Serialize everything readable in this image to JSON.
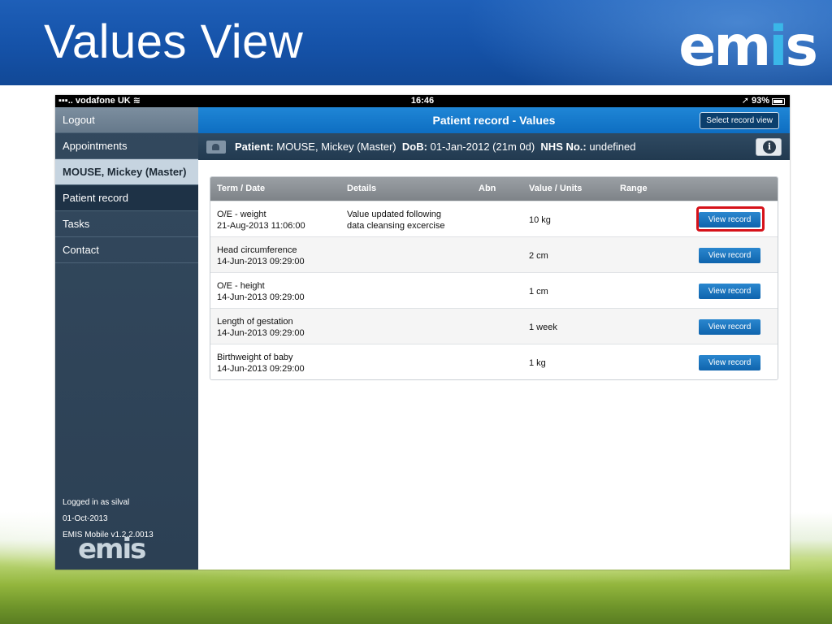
{
  "slide": {
    "title": "Values View",
    "logo_left": "em",
    "logo_accent": "i",
    "logo_right": "s"
  },
  "status_bar": {
    "carrier": "▪▪▪.. vodafone UK",
    "time": "16:46",
    "battery": "93%"
  },
  "sidebar": {
    "items": [
      {
        "label": "Logout"
      },
      {
        "label": "Appointments"
      },
      {
        "label": "MOUSE, Mickey (Master)"
      },
      {
        "label": "Patient record"
      },
      {
        "label": "Tasks"
      },
      {
        "label": "Contact"
      }
    ],
    "footer": {
      "logged_in": "Logged in as silval",
      "date": "01-Oct-2013",
      "version": "EMIS Mobile v1.2.2.0013",
      "logo": "emis"
    }
  },
  "topbar": {
    "title": "Patient record - Values",
    "select_view_label": "Select record view"
  },
  "patient_bar": {
    "patient_label": "Patient:",
    "patient_name": "MOUSE, Mickey (Master)",
    "dob_label": "DoB:",
    "dob": "01-Jan-2012 (21m 0d)",
    "nhs_label": "NHS No.:",
    "nhs": "undefined",
    "info_glyph": "i"
  },
  "table": {
    "columns": [
      "Term / Date",
      "Details",
      "Abn",
      "Value / Units",
      "Range"
    ],
    "button_label": "View record",
    "rows": [
      {
        "term": "O/E - weight",
        "date": "21-Aug-2013 11:06:00",
        "details_1": "Value updated following",
        "details_2": "data cleansing excercise",
        "value": "10 kg"
      },
      {
        "term": "Head circumference",
        "date": "14-Jun-2013 09:29:00",
        "details_1": "",
        "details_2": "",
        "value": "2 cm"
      },
      {
        "term": "O/E - height",
        "date": "14-Jun-2013 09:29:00",
        "details_1": "",
        "details_2": "",
        "value": "1 cm"
      },
      {
        "term": "Length of gestation",
        "date": "14-Jun-2013 09:29:00",
        "details_1": "",
        "details_2": "",
        "value": "1 week"
      },
      {
        "term": "Birthweight of baby",
        "date": "14-Jun-2013 09:29:00",
        "details_1": "",
        "details_2": "",
        "value": "1 kg"
      }
    ]
  },
  "colors": {
    "header_blue": "#1552a8",
    "logo_accent": "#3ab7e8",
    "button_blue": "#0f64ad",
    "highlight_red": "#d6121a"
  }
}
